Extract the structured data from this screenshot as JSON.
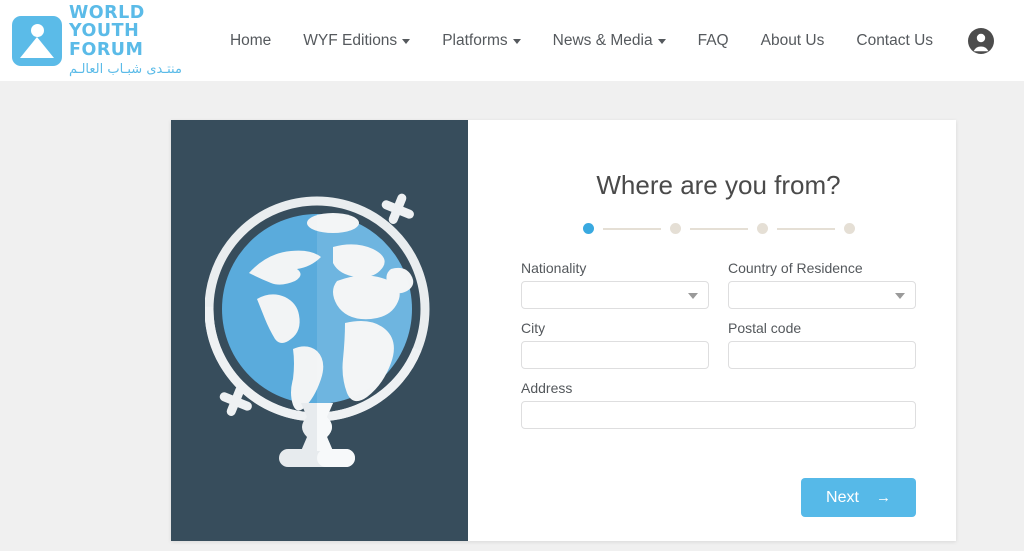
{
  "header": {
    "logo": {
      "icon": "wyf-logo-icon",
      "lines": [
        "WORLD",
        "YOUTH",
        "FORUM"
      ],
      "arabic": "منتـدى شبـاب العالـم"
    },
    "nav": [
      {
        "label": "Home",
        "has_dropdown": false
      },
      {
        "label": "WYF Editions",
        "has_dropdown": true
      },
      {
        "label": "Platforms",
        "has_dropdown": true
      },
      {
        "label": "News & Media",
        "has_dropdown": true
      },
      {
        "label": "FAQ",
        "has_dropdown": false
      },
      {
        "label": "About Us",
        "has_dropdown": false
      },
      {
        "label": "Contact Us",
        "has_dropdown": false
      }
    ],
    "account_icon": "account-circle-icon"
  },
  "card": {
    "illustration": {
      "icon": "globe-on-stand-icon",
      "background_color": "#374d5c",
      "sphere_color": "#5aabdc",
      "land_color": "#f2f4f5",
      "frame_color": "#eef1f3"
    },
    "form": {
      "title": "Where are you from?",
      "stepper": {
        "total_steps": 4,
        "current_step": 1,
        "active_color": "#39a9e0",
        "inactive_color": "#e5dfd5"
      },
      "fields": [
        {
          "label": "Nationality",
          "type": "select",
          "value": "",
          "placeholder": ""
        },
        {
          "label": "Country of Residence",
          "type": "select",
          "value": "",
          "placeholder": ""
        },
        {
          "label": "City",
          "type": "text",
          "value": "",
          "placeholder": ""
        },
        {
          "label": "Postal code",
          "type": "text",
          "value": "",
          "placeholder": ""
        },
        {
          "label": "Address",
          "type": "text",
          "value": "",
          "placeholder": ""
        }
      ],
      "next_button": {
        "label": "Next",
        "icon": "arrow-right-icon",
        "arrow": "→",
        "color": "#56b9e8"
      }
    }
  },
  "page": {
    "background_color": "#f0f0f0"
  }
}
